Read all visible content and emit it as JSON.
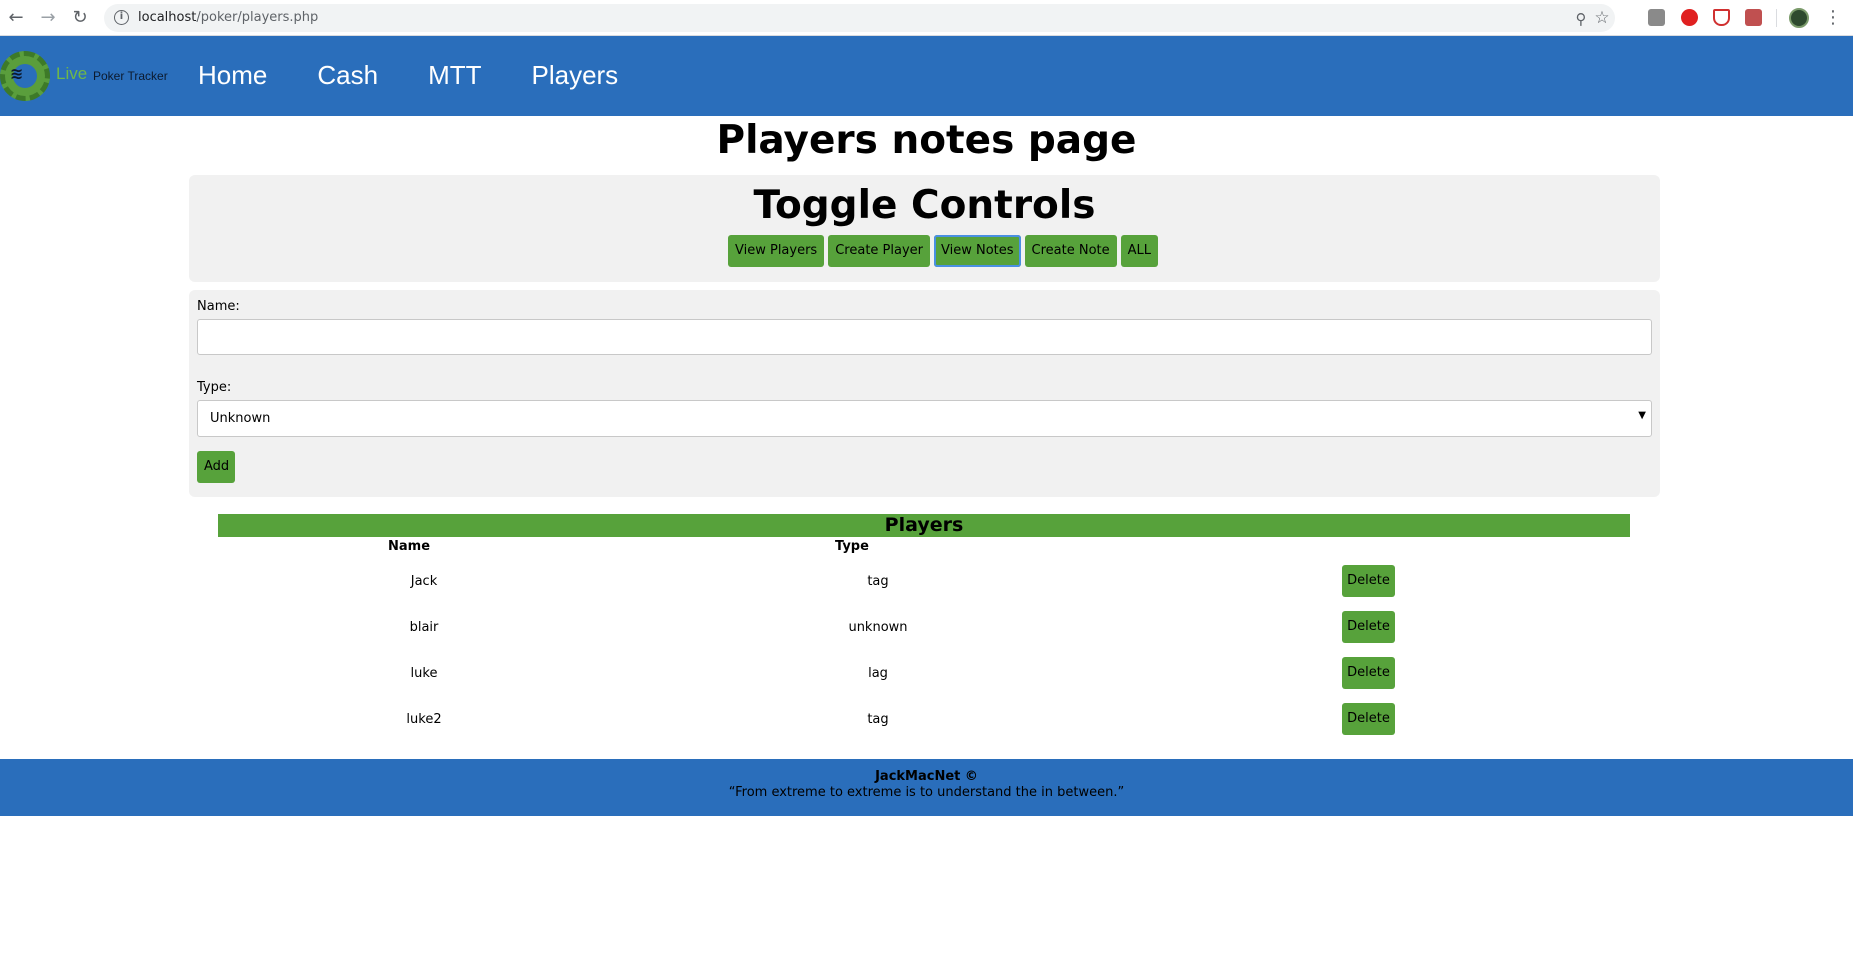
{
  "browser": {
    "url_host": "localhost",
    "url_path": "/poker/players.php"
  },
  "header": {
    "logo_live": "Live",
    "logo_tracker": "Poker Tracker",
    "nav": [
      {
        "label": "Home"
      },
      {
        "label": "Cash"
      },
      {
        "label": "MTT"
      },
      {
        "label": "Players"
      }
    ]
  },
  "page": {
    "title": "Players notes page"
  },
  "toggle": {
    "title": "Toggle Controls",
    "buttons": [
      {
        "label": "View Players"
      },
      {
        "label": "Create Player"
      },
      {
        "label": "View Notes"
      },
      {
        "label": "Create Note"
      },
      {
        "label": "ALL"
      }
    ]
  },
  "form": {
    "name_label": "Name:",
    "name_value": "",
    "type_label": "Type:",
    "type_value": "Unknown",
    "add_label": "Add"
  },
  "players": {
    "title": "Players",
    "columns": {
      "name": "Name",
      "type": "Type"
    },
    "rows": [
      {
        "name": "Jack",
        "type": "tag",
        "action": "Delete"
      },
      {
        "name": "blair",
        "type": "unknown",
        "action": "Delete"
      },
      {
        "name": "luke",
        "type": "lag",
        "action": "Delete"
      },
      {
        "name": "luke2",
        "type": "tag",
        "action": "Delete"
      }
    ]
  },
  "footer": {
    "brand": "JackMacNet ©",
    "quote": "“From extreme to extreme is to understand the in between.”"
  },
  "colors": {
    "header_blue": "#2a6ebb",
    "button_green": "#57a23b",
    "panel_gray": "#f1f1f1"
  }
}
